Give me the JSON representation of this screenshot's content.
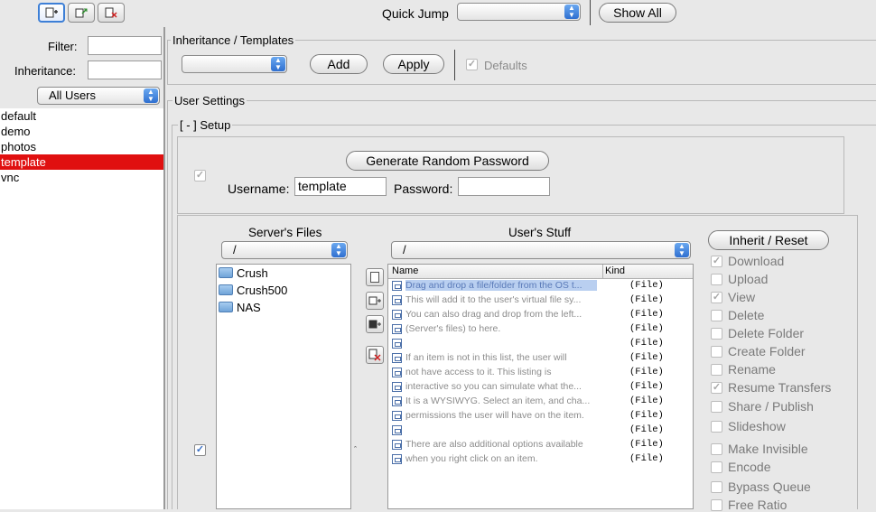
{
  "toolbar": {
    "quick_jump_label": "Quick Jump",
    "quick_jump_value": "",
    "show_all_label": "Show All",
    "icons": [
      "new-user-icon",
      "duplicate-user-icon",
      "delete-user-icon"
    ]
  },
  "sidebar": {
    "filter_label": "Filter:",
    "filter_value": "",
    "inheritance_label": "Inheritance:",
    "inheritance_value": "",
    "group_select": "All Users",
    "users": [
      {
        "name": "default",
        "selected": false
      },
      {
        "name": "demo",
        "selected": false
      },
      {
        "name": "photos",
        "selected": false
      },
      {
        "name": "template",
        "selected": true
      },
      {
        "name": "vnc",
        "selected": false
      }
    ]
  },
  "inheritance": {
    "title": "Inheritance / Templates",
    "select_value": "",
    "add_label": "Add",
    "apply_label": "Apply",
    "defaults_label": "Defaults",
    "defaults_checked": true
  },
  "user_settings": {
    "title": "User Settings",
    "setup_title": "[ - ] Setup",
    "generate_password_label": "Generate Random Password",
    "username_label": "Username:",
    "username_value": "template",
    "password_label": "Password:",
    "password_value": ""
  },
  "files": {
    "servers_files_title": "Server's Files",
    "servers_path": "/",
    "users_stuff_title": "User's Stuff",
    "users_path": "/",
    "server_items": [
      "Crush",
      "Crush500",
      "NAS"
    ],
    "column_name": "Name",
    "column_kind": "Kind",
    "user_items": [
      {
        "name": "Drag and drop a file/folder from the OS t...",
        "kind": "(File)",
        "selected": true
      },
      {
        "name": "This will add it to the user's virtual file sy...",
        "kind": "(File)"
      },
      {
        "name": "You can also drag and drop from the left...",
        "kind": "(File)"
      },
      {
        "name": "(Server's files) to here.",
        "kind": "(File)"
      },
      {
        "name": "",
        "kind": "(File)"
      },
      {
        "name": "If an item is not in this list, the user will",
        "kind": "(File)"
      },
      {
        "name": "not have access to it.  This listing is",
        "kind": "(File)"
      },
      {
        "name": "interactive so you can simulate what the...",
        "kind": "(File)"
      },
      {
        "name": "It is a WYSIWYG.  Select an item, and cha...",
        "kind": "(File)"
      },
      {
        "name": "permissions the user will have on the item.",
        "kind": "(File)"
      },
      {
        "name": "",
        "kind": "(File)"
      },
      {
        "name": "There are also additional options available",
        "kind": "(File)"
      },
      {
        "name": "when you right click on an item.",
        "kind": "(File)"
      }
    ]
  },
  "permissions": {
    "inherit_reset_label": "Inherit / Reset",
    "items": [
      {
        "label": "Download",
        "checked": true
      },
      {
        "label": "Upload",
        "checked": false
      },
      {
        "label": "View",
        "checked": true
      },
      {
        "label": "Delete",
        "checked": false
      },
      {
        "label": "Delete Folder",
        "checked": false
      },
      {
        "label": "Create Folder",
        "checked": false
      },
      {
        "label": "Rename",
        "checked": false
      },
      {
        "label": "Resume Transfers",
        "checked": true
      },
      {
        "label": "Share / Publish",
        "checked": false
      },
      {
        "label": "Slideshow",
        "checked": false
      },
      {
        "label": "Make Invisible",
        "checked": false
      },
      {
        "label": "Encode",
        "checked": false
      },
      {
        "label": "Bypass Queue",
        "checked": false
      },
      {
        "label": "Free Ratio",
        "checked": false
      }
    ]
  },
  "colors": {
    "selection": "#e01010",
    "accent": "#2f6fd0",
    "checkmark": "#3a6fc4"
  }
}
